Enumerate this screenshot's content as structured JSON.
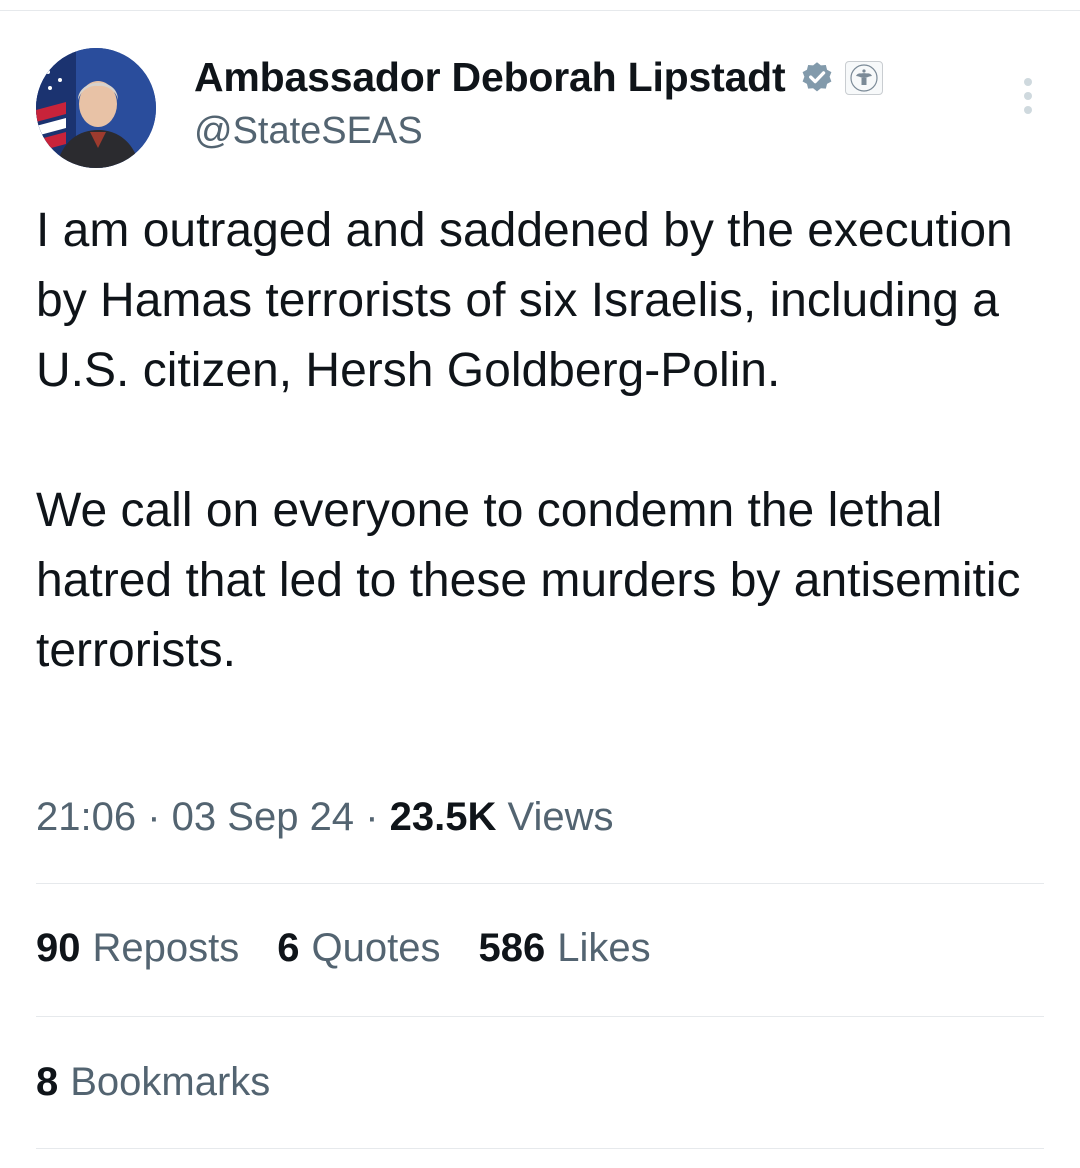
{
  "author": {
    "display_name": "Ambassador Deborah Lipstadt",
    "handle": "@StateSEAS",
    "avatar_icon": "profile-photo-avatar",
    "verified_icon": "verified-badge-icon",
    "affiliation_icon": "us-state-department-seal-icon"
  },
  "post": {
    "paragraphs": [
      "I am outraged and saddened by the execution by Hamas terrorists of six Israelis, including a U.S. citizen, Hersh Goldberg-Polin.",
      "We call on everyone to condemn the lethal hatred that led to these murders by antisemitic terrorists."
    ]
  },
  "meta": {
    "time": "21:06",
    "separator": "·",
    "date": "03 Sep 24",
    "views_count": "23.5K",
    "views_label": "Views"
  },
  "stats": {
    "reposts_count": "90",
    "reposts_label": "Reposts",
    "quotes_count": "6",
    "quotes_label": "Quotes",
    "likes_count": "586",
    "likes_label": "Likes"
  },
  "bookmarks": {
    "count": "8",
    "label": "Bookmarks"
  },
  "colors": {
    "text_primary": "#0f1419",
    "text_secondary": "#536471",
    "divider": "#e6e9ec",
    "verified_badge": "#829aab"
  }
}
